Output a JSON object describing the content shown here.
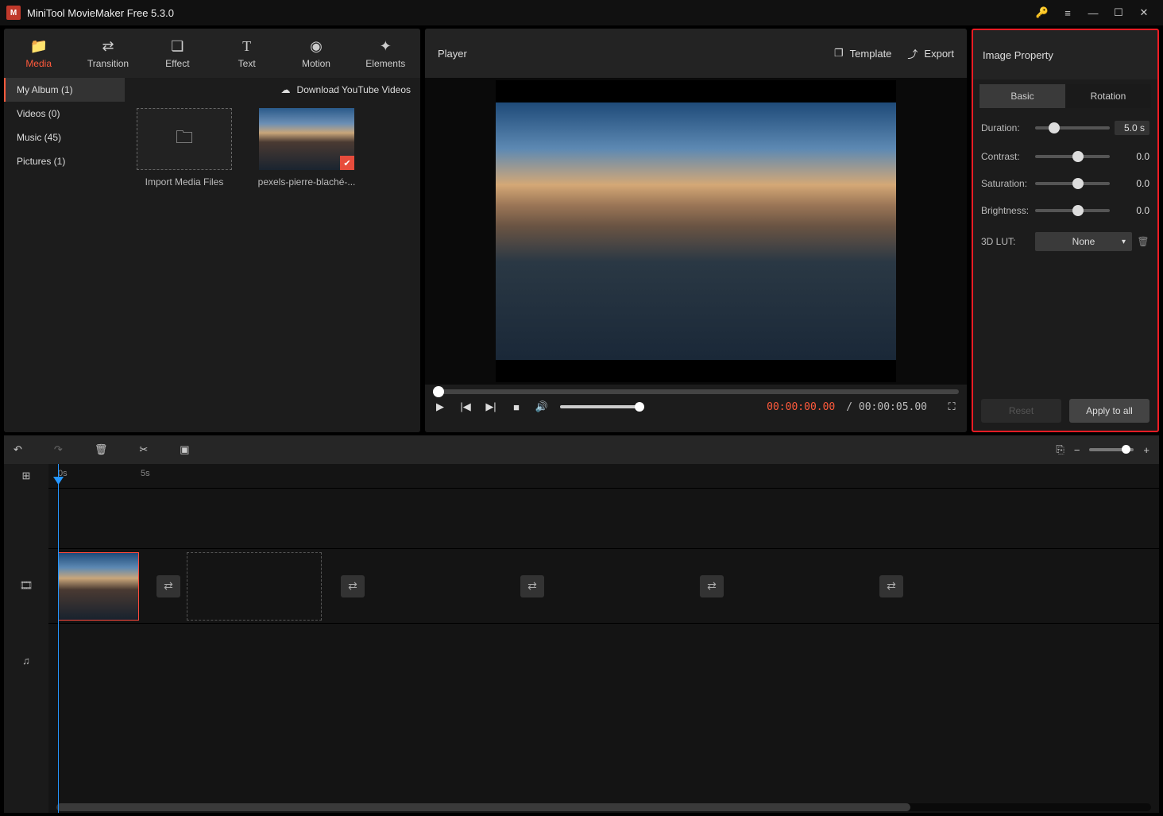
{
  "titlebar": {
    "app_title": "MiniTool MovieMaker Free 5.3.0"
  },
  "media_tabs": [
    {
      "label": "Media",
      "icon": "📁",
      "active": true
    },
    {
      "label": "Transition",
      "icon": "⇄",
      "active": false
    },
    {
      "label": "Effect",
      "icon": "❏",
      "active": false
    },
    {
      "label": "Text",
      "icon": "T",
      "active": false
    },
    {
      "label": "Motion",
      "icon": "◉",
      "active": false
    },
    {
      "label": "Elements",
      "icon": "✦",
      "active": false
    }
  ],
  "media_sidebar": [
    {
      "label": "My Album (1)",
      "active": true
    },
    {
      "label": "Videos (0)",
      "active": false
    },
    {
      "label": "Music (45)",
      "active": false
    },
    {
      "label": "Pictures (1)",
      "active": false
    }
  ],
  "yt_link": "Download YouTube Videos",
  "thumbs": {
    "import_label": "Import Media Files",
    "clip_label": "pexels-pierre-blaché-..."
  },
  "player": {
    "title": "Player",
    "template_btn": "Template",
    "export_btn": "Export",
    "current_time": "00:00:00.00",
    "duration": "/ 00:00:05.00"
  },
  "properties": {
    "title": "Image Property",
    "tabs": {
      "basic": "Basic",
      "rotation": "Rotation"
    },
    "rows": {
      "duration": {
        "label": "Duration:",
        "value": "5.0 s",
        "pos": 18
      },
      "contrast": {
        "label": "Contrast:",
        "value": "0.0",
        "pos": 50
      },
      "saturation": {
        "label": "Saturation:",
        "value": "0.0",
        "pos": 50
      },
      "brightness": {
        "label": "Brightness:",
        "value": "0.0",
        "pos": 50
      },
      "lut": {
        "label": "3D LUT:",
        "value": "None"
      }
    },
    "reset_btn": "Reset",
    "apply_btn": "Apply to all"
  },
  "timeline": {
    "ruler": {
      "t0": "0s",
      "t1": "5s"
    }
  }
}
